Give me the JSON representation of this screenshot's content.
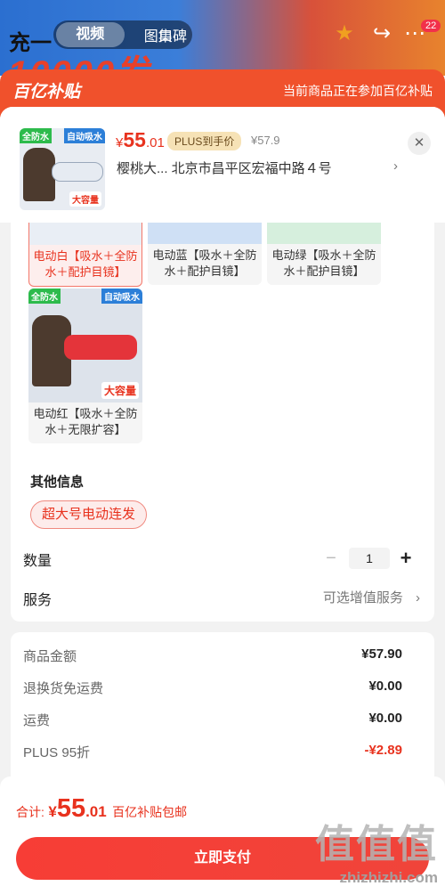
{
  "top": {
    "banner_text_big": "10000发",
    "banner_text_small": "充一",
    "tabs": [
      "视频",
      "图集",
      "口碑"
    ],
    "active_tab": "视频",
    "cart_badge": "22"
  },
  "subsidy": {
    "logo": "百亿补贴",
    "note": "当前商品正在参加百亿补贴"
  },
  "product": {
    "price_symbol": "¥",
    "price_int": "55",
    "price_dec": ".01",
    "plus_tag": "PLUS到手价",
    "orig_price": "¥57.9",
    "address": "樱桃大...  北京市昌平区宏福中路４号",
    "thumb_tags": [
      "全防水",
      "自动吸水"
    ],
    "thumb_caption": "大容量"
  },
  "variants": [
    {
      "label": "电动白【吸水＋全防水＋配护目镜】",
      "selected": true,
      "color": "#e9eef5"
    },
    {
      "label": "电动蓝【吸水＋全防水＋配护目镜】",
      "selected": false,
      "color": "#3a86d9"
    },
    {
      "label": "电动绿【吸水＋全防水＋配护目镜】",
      "selected": false,
      "color": "#3cb65a"
    },
    {
      "label": "电动红【吸水＋全防水＋无限扩容】",
      "selected": false,
      "color": "#e4343a"
    }
  ],
  "other_info": {
    "title": "其他信息",
    "chip": "超大号电动连发"
  },
  "quantity": {
    "label": "数量",
    "value": "1",
    "minus": "−",
    "plus": "+"
  },
  "service": {
    "label": "服务",
    "value": "可选增值服务"
  },
  "costs": [
    {
      "k": "商品金额",
      "v": "¥57.90",
      "discount": false
    },
    {
      "k": "退换货免运费",
      "v": "¥0.00",
      "discount": false
    },
    {
      "k": "运费",
      "v": "¥0.00",
      "discount": false
    },
    {
      "k": "PLUS 95折",
      "v": "-¥2.89",
      "discount": true
    }
  ],
  "bottom": {
    "total_label": "合计:",
    "sym": "¥",
    "int": "55",
    "dec": ".01",
    "ship_note": "百亿补贴包邮",
    "pay_button": "立即支付"
  },
  "watermark": {
    "logo": "值值值",
    "url": "zhizhizhi.com"
  },
  "colors": {
    "accent": "#e8321e",
    "subsidy_bar": "#f0512c",
    "pay_button": "#f73d36"
  }
}
